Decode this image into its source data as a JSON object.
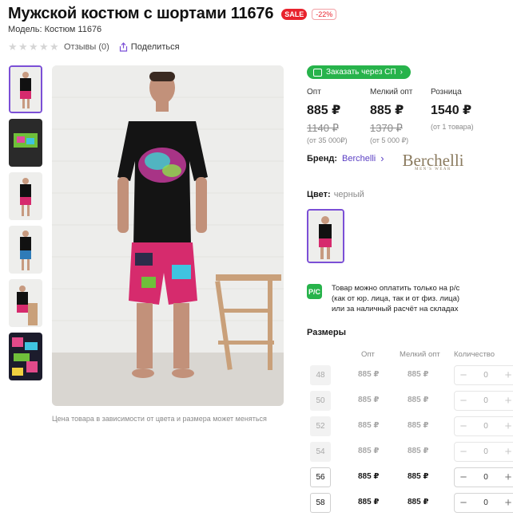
{
  "header": {
    "title": "Мужской костюм с шортами 11676",
    "sale_badge": "SALE",
    "discount_badge": "-22%",
    "model": "Модель: Костюм 11676"
  },
  "rating": {
    "stars_filled": 0,
    "stars_total": 5,
    "reviews": "Отзывы (0)",
    "share": "Поделиться"
  },
  "gallery": {
    "thumb_count": 6,
    "active_index": 0,
    "note": "Цена товара в зависимости от цвета и размера может меняться"
  },
  "sp_button": "Заказать через СП",
  "prices": [
    {
      "label": "Опт",
      "current": "885 ₽",
      "old": "1140 ₽",
      "condition": "(от 35 000₽)"
    },
    {
      "label": "Мелкий опт",
      "current": "885 ₽",
      "old": "1370 ₽",
      "condition": "(от 5 000 ₽)"
    },
    {
      "label": "Розница",
      "current": "1540 ₽",
      "old": "",
      "condition": "(от 1 товара)"
    }
  ],
  "brand": {
    "label": "Бренд:",
    "name": "Berchelli",
    "logo_name": "Berchelli",
    "logo_sub": "MEN'S WEAR"
  },
  "color": {
    "label": "Цвет:",
    "value": "черный"
  },
  "payment": {
    "icon_text": "Р/С",
    "lines": [
      "Товар можно оплатить только на р/с",
      "(как от юр. лица, так и от физ. лица)",
      "или за наличный расчёт на складах"
    ]
  },
  "sizes": {
    "title": "Размеры",
    "headers": [
      "Опт",
      "Мелкий опт",
      "Количество"
    ],
    "rows": [
      {
        "size": "48",
        "opt": "885 ₽",
        "small_opt": "885 ₽",
        "qty": "0",
        "available": false
      },
      {
        "size": "50",
        "opt": "885 ₽",
        "small_opt": "885 ₽",
        "qty": "0",
        "available": false
      },
      {
        "size": "52",
        "opt": "885 ₽",
        "small_opt": "885 ₽",
        "qty": "0",
        "available": false
      },
      {
        "size": "54",
        "opt": "885 ₽",
        "small_opt": "885 ₽",
        "qty": "0",
        "available": false
      },
      {
        "size": "56",
        "opt": "885 ₽",
        "small_opt": "885 ₽",
        "qty": "0",
        "available": true
      },
      {
        "size": "58",
        "opt": "885 ₽",
        "small_opt": "885 ₽",
        "qty": "0",
        "available": true
      }
    ],
    "minus": "−",
    "plus": "+"
  },
  "colors": {
    "accent": "#7b4fd6",
    "sale": "#e8232d",
    "green": "#27b34b",
    "link": "#5b3fc4"
  }
}
